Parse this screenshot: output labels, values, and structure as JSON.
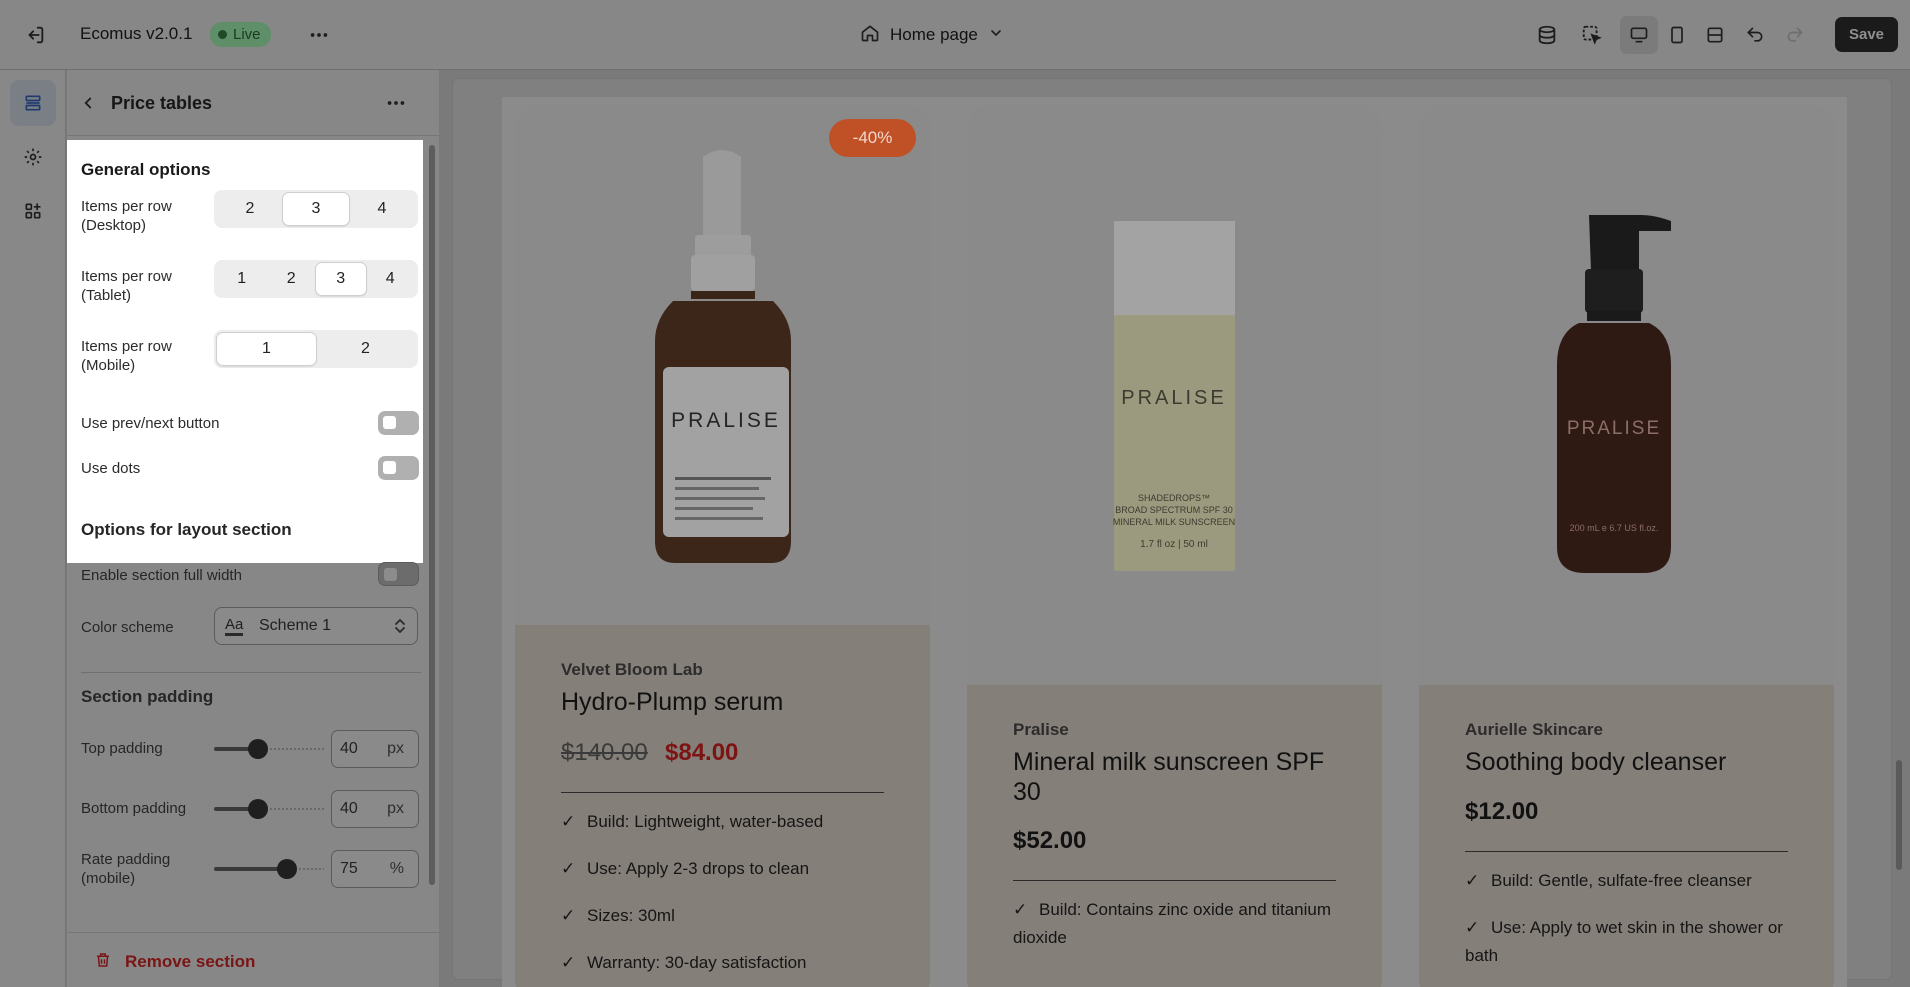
{
  "topbar": {
    "app_title": "Ecomus v2.0.1",
    "status_badge": "Live",
    "page_selector": "Home page",
    "save_label": "Save",
    "icons": [
      "exit-icon",
      "more-icon",
      "home-icon",
      "chevron-down-icon",
      "database-icon",
      "select-cursor-icon",
      "desktop-icon",
      "tablet-icon",
      "fullwidth-icon",
      "undo-icon",
      "redo-icon"
    ]
  },
  "sidebar": {
    "items": [
      {
        "icon": "sections-icon",
        "active": true
      },
      {
        "icon": "gear-icon",
        "active": false
      },
      {
        "icon": "apps-icon",
        "active": false
      }
    ]
  },
  "panel": {
    "title": "Price tables",
    "general": {
      "heading": "General options",
      "desktop_label": "Items per row (Desktop)",
      "desktop_options": [
        "2",
        "3",
        "4"
      ],
      "desktop_selected": "3",
      "tablet_label": "Items per row (Tablet)",
      "tablet_options": [
        "1",
        "2",
        "3",
        "4"
      ],
      "tablet_selected": "3",
      "mobile_label": "Items per row (Mobile)",
      "mobile_options": [
        "1",
        "2"
      ],
      "mobile_selected": "1",
      "prev_next_label": "Use prev/next button",
      "prev_next_on": false,
      "dots_label": "Use dots",
      "dots_on": false
    },
    "layout": {
      "heading": "Options for layout section",
      "full_width_label": "Enable section full width",
      "full_width_on": false,
      "color_scheme_label": "Color scheme",
      "color_scheme_value": "Scheme 1",
      "color_scheme_icon": "Aa"
    },
    "padding": {
      "heading": "Section padding",
      "top_label": "Top padding",
      "top_value": "40",
      "top_unit": "px",
      "bottom_label": "Bottom padding",
      "bottom_value": "40",
      "bottom_unit": "px",
      "rate_label": "Rate padding (mobile)",
      "rate_value": "75",
      "rate_unit": "%"
    },
    "remove_label": "Remove section"
  },
  "products": [
    {
      "badge": "-40%",
      "brand": "Velvet Bloom Lab",
      "name": "Hydro-Plump serum",
      "price_old": "$140.00",
      "price": "$84.00",
      "bottle_label": "PRALISE",
      "features": [
        "Build: Lightweight, water-based",
        "Use: Apply 2-3 drops to clean",
        "Sizes: 30ml",
        "Warranty: 30-day satisfaction"
      ]
    },
    {
      "brand": "Pralise",
      "name": "Mineral milk sunscreen SPF 30",
      "price": "$52.00",
      "bottle_label": "PRALISE",
      "bottle_small": "SHADEDROPS™ BROAD SPECTRUM SPF 30 MINERAL MILK SUNSCREEN",
      "bottle_size": "1.7 fl oz | 50 ml",
      "features": [
        "Build: Contains zinc oxide and titanium dioxide"
      ]
    },
    {
      "brand": "Aurielle Skincare",
      "name": "Soothing body cleanser",
      "price": "$12.00",
      "bottle_label": "PRALISE",
      "bottle_size": "200 mL e 6.7 US fl.oz.",
      "features": [
        "Build: Gentle, sulfate-free cleanser",
        "Use: Apply to wet skin in the shower or bath"
      ]
    }
  ],
  "colors": {
    "overlay": "#878787",
    "panel_highlight": "#ffffff",
    "sale_price": "#7d1414",
    "badge": "#c05126",
    "live_badge": "#5f8f68"
  }
}
